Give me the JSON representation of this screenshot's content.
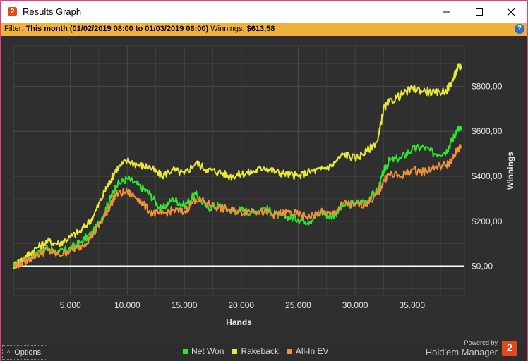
{
  "window": {
    "title": "Results Graph",
    "app_icon_glyph": "2"
  },
  "filter": {
    "label": "Filter:",
    "value": "This month (01/02/2019 08:00 to 01/03/2019 08:00)",
    "winnings_label": "Winnings:",
    "winnings_value": "$613,58",
    "help_glyph": "?"
  },
  "bottom": {
    "options_label": "Options",
    "powered_by": "Powered by",
    "brand_name": "Hold'em Manager",
    "brand_logo_glyph": "2"
  },
  "colors": {
    "net_won": "#2ee62e",
    "rakeback": "#e8e83a",
    "all_in_ev": "#f0903a",
    "zero_line": "#ffffff",
    "grid": "#4a4a4a",
    "plot_bg": "#2f2f2f"
  },
  "chart_data": {
    "type": "line",
    "xlabel": "Hands",
    "ylabel": "Winnings",
    "xlim": [
      0,
      39600
    ],
    "ylim": [
      -130,
      980
    ],
    "x_ticks": [
      5000,
      10000,
      15000,
      20000,
      25000,
      30000,
      35000
    ],
    "x_tick_labels": [
      "5.000",
      "10.000",
      "15.000",
      "20.000",
      "25.000",
      "30.000",
      "35.000"
    ],
    "y_ticks": [
      0,
      200,
      400,
      600,
      800
    ],
    "y_tick_labels": [
      "$0,00",
      "$200,00",
      "$400,00",
      "$600,00",
      "$800,00"
    ],
    "grid": true,
    "legend_position": "bottom",
    "series": [
      {
        "name": "Net Won",
        "color_key": "net_won",
        "x": [
          0,
          1000,
          2000,
          3000,
          4000,
          5000,
          6000,
          7000,
          8000,
          8500,
          9000,
          10000,
          11000,
          12000,
          13000,
          14000,
          15000,
          16000,
          17000,
          18000,
          19000,
          20000,
          21000,
          22000,
          23000,
          24000,
          25000,
          26000,
          27000,
          28000,
          29000,
          30000,
          31000,
          32000,
          32500,
          33000,
          34000,
          35000,
          36000,
          37000,
          38000,
          38500,
          39000,
          39300
        ],
        "y": [
          0,
          30,
          60,
          80,
          60,
          80,
          110,
          150,
          240,
          300,
          360,
          390,
          360,
          320,
          250,
          300,
          270,
          320,
          260,
          270,
          250,
          250,
          240,
          260,
          230,
          220,
          210,
          200,
          240,
          220,
          270,
          280,
          290,
          340,
          420,
          470,
          480,
          520,
          530,
          500,
          510,
          560,
          610,
          605
        ]
      },
      {
        "name": "Rakeback",
        "color_key": "rakeback",
        "x": [
          0,
          1000,
          2000,
          3000,
          4000,
          5000,
          6000,
          7000,
          8000,
          8500,
          9000,
          10000,
          11000,
          12000,
          13000,
          14000,
          15000,
          16000,
          17000,
          18000,
          19000,
          20000,
          21000,
          22000,
          23000,
          24000,
          25000,
          26000,
          27000,
          28000,
          29000,
          30000,
          31000,
          32000,
          32500,
          33000,
          34000,
          35000,
          36000,
          37000,
          38000,
          38500,
          39000,
          39300
        ],
        "y": [
          0,
          40,
          80,
          110,
          100,
          130,
          160,
          220,
          330,
          380,
          430,
          470,
          450,
          440,
          400,
          430,
          410,
          460,
          430,
          420,
          400,
          410,
          420,
          440,
          420,
          410,
          400,
          420,
          430,
          450,
          500,
          480,
          510,
          560,
          700,
          730,
          760,
          790,
          780,
          770,
          780,
          820,
          880,
          890
        ]
      },
      {
        "name": "All-In EV",
        "color_key": "all_in_ev",
        "x": [
          0,
          1000,
          2000,
          3000,
          4000,
          5000,
          6000,
          7000,
          8000,
          8500,
          9000,
          10000,
          11000,
          12000,
          13000,
          14000,
          15000,
          16000,
          17000,
          18000,
          19000,
          20000,
          21000,
          22000,
          23000,
          24000,
          25000,
          26000,
          27000,
          28000,
          29000,
          30000,
          31000,
          32000,
          32500,
          33000,
          34000,
          35000,
          36000,
          37000,
          38000,
          38500,
          39000,
          39300
        ],
        "y": [
          0,
          20,
          50,
          70,
          50,
          70,
          90,
          140,
          220,
          270,
          320,
          330,
          300,
          240,
          230,
          250,
          240,
          300,
          280,
          260,
          250,
          240,
          250,
          240,
          230,
          240,
          230,
          220,
          240,
          230,
          280,
          270,
          280,
          320,
          380,
          410,
          400,
          430,
          420,
          440,
          450,
          470,
          520,
          530
        ]
      }
    ]
  }
}
